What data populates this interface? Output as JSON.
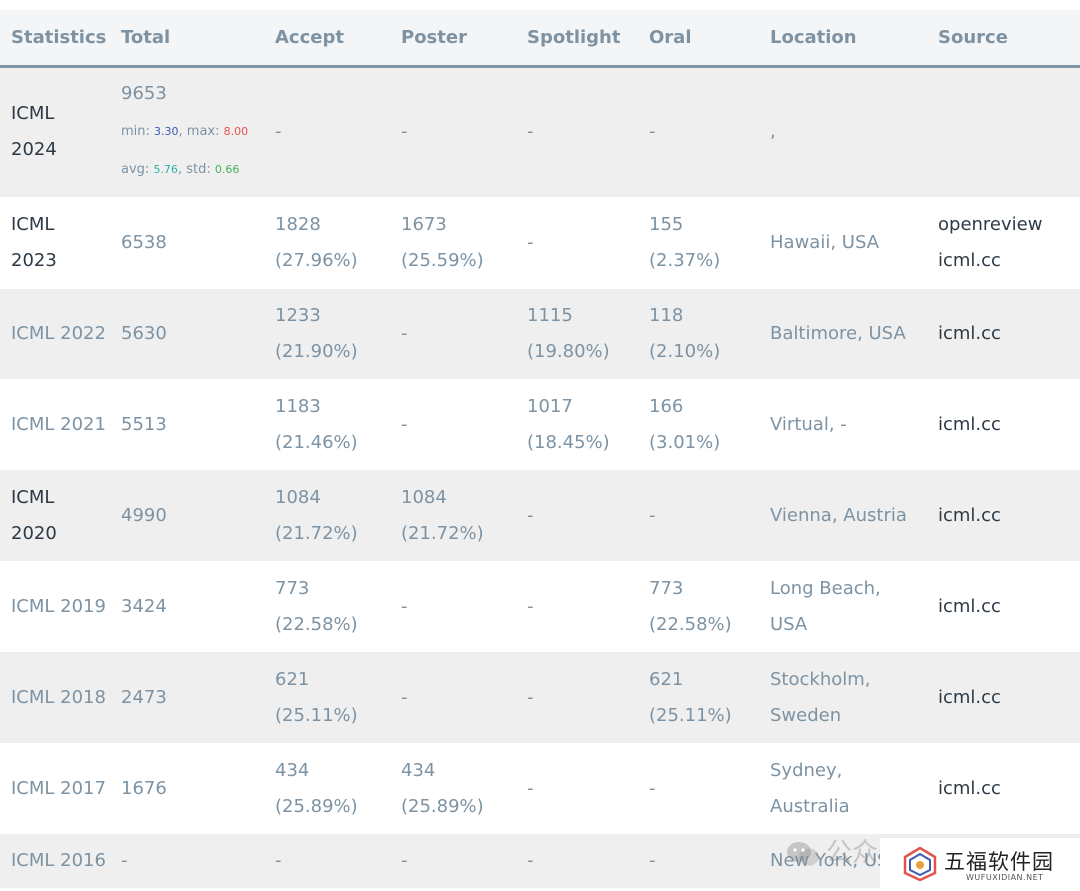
{
  "headers": [
    "Statistics",
    "Total",
    "Accept",
    "Poster",
    "Spotlight",
    "Oral",
    "Location",
    "Source"
  ],
  "row2024": {
    "name_l1": "ICML",
    "name_l2": "2024",
    "total": "9653",
    "min_label": "min: ",
    "min": "3.30",
    "max_label": ", max: ",
    "max": "8.00",
    "avg_label": "avg: ",
    "avg": "5.76",
    "std_label": ", std: ",
    "std": "0.66",
    "accept": "-",
    "poster": "-",
    "spotlight": "-",
    "oral": "-",
    "location": ",",
    "source": ""
  },
  "rows": [
    {
      "name": [
        "ICML",
        "2023"
      ],
      "total": "6538",
      "accept": [
        "1828",
        "(27.96%)"
      ],
      "poster": [
        "1673",
        "(25.59%)"
      ],
      "spotlight": [
        "-"
      ],
      "oral": [
        "155 (2.37%)"
      ],
      "location": [
        "Hawaii, USA"
      ],
      "source": [
        "openreview",
        "icml.cc"
      ]
    },
    {
      "name": [
        "ICML 2022"
      ],
      "total": "5630",
      "accept": [
        "1233",
        "(21.90%)"
      ],
      "poster": [
        "-"
      ],
      "spotlight": [
        "1115",
        "(19.80%)"
      ],
      "oral": [
        "118 (2.10%)"
      ],
      "location": [
        "Baltimore, USA"
      ],
      "source": [
        "icml.cc"
      ]
    },
    {
      "name": [
        "ICML 2021"
      ],
      "total": "5513",
      "accept": [
        "1183",
        "(21.46%)"
      ],
      "poster": [
        "-"
      ],
      "spotlight": [
        "1017",
        "(18.45%)"
      ],
      "oral": [
        "166 (3.01%)"
      ],
      "location": [
        "Virtual, -"
      ],
      "source": [
        "icml.cc"
      ]
    },
    {
      "name": [
        "ICML",
        "2020"
      ],
      "total": "4990",
      "accept": [
        "1084",
        "(21.72%)"
      ],
      "poster": [
        "1084",
        "(21.72%)"
      ],
      "spotlight": [
        "-"
      ],
      "oral": [
        "-"
      ],
      "location": [
        "Vienna, Austria"
      ],
      "source": [
        "icml.cc"
      ]
    },
    {
      "name": [
        "ICML 2019"
      ],
      "total": "3424",
      "accept": [
        "773",
        "(22.58%)"
      ],
      "poster": [
        "-"
      ],
      "spotlight": [
        "-"
      ],
      "oral": [
        "773",
        "(22.58%)"
      ],
      "location": [
        "Long Beach,",
        "USA"
      ],
      "source": [
        "icml.cc"
      ]
    },
    {
      "name": [
        "ICML 2018"
      ],
      "total": "2473",
      "accept": [
        "621 (25.11%)"
      ],
      "poster": [
        "-"
      ],
      "spotlight": [
        "-"
      ],
      "oral": [
        "621",
        "(25.11%)"
      ],
      "location": [
        "Stockholm,",
        "Sweden"
      ],
      "source": [
        "icml.cc"
      ]
    },
    {
      "name": [
        "ICML 2017"
      ],
      "total": "1676",
      "accept": [
        "434",
        "(25.89%)"
      ],
      "poster": [
        "434",
        "(25.89%)"
      ],
      "spotlight": [
        "-"
      ],
      "oral": [
        "-"
      ],
      "location": [
        "Sydney,",
        "Australia"
      ],
      "source": [
        "icml.cc"
      ]
    },
    {
      "name": [
        "ICML 2016"
      ],
      "total": "-",
      "accept": [
        "-"
      ],
      "poster": [
        "-"
      ],
      "spotlight": [
        "-"
      ],
      "oral": [
        "-"
      ],
      "location": [
        "New York, US"
      ],
      "source": [
        ""
      ]
    }
  ],
  "watermark": {
    "text": "公众号 · 新智元"
  },
  "logo": {
    "title": "五福软件园",
    "subtitle": "WUFUXIDIAN.NET"
  }
}
